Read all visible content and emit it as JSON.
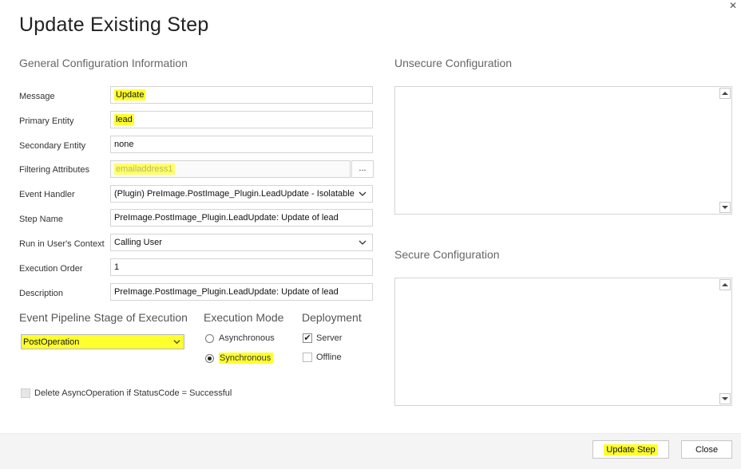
{
  "dialog": {
    "title": "Update Existing Step",
    "close_icon": "close-icon"
  },
  "general": {
    "heading": "General Configuration Information",
    "fields": {
      "message": {
        "label": "Message",
        "value": "Update"
      },
      "primary_entity": {
        "label": "Primary Entity",
        "value": "lead"
      },
      "secondary_entity": {
        "label": "Secondary Entity",
        "value": "none"
      },
      "filtering_attributes": {
        "label": "Filtering Attributes",
        "value": "emailaddress1",
        "button": "..."
      },
      "event_handler": {
        "label": "Event Handler",
        "value": "(Plugin) PreImage.PostImage_Plugin.LeadUpdate - Isolatable"
      },
      "step_name": {
        "label": "Step Name",
        "value": "PreImage.PostImage_Plugin.LeadUpdate: Update of lead"
      },
      "run_in_context": {
        "label": "Run in User's Context",
        "value": "Calling User"
      },
      "execution_order": {
        "label": "Execution Order",
        "value": "1"
      },
      "description": {
        "label": "Description",
        "value": "PreImage.PostImage_Plugin.LeadUpdate: Update of lead"
      }
    }
  },
  "pipeline": {
    "heading": "Event Pipeline Stage of Execution",
    "selected": "PostOperation"
  },
  "execution_mode": {
    "heading": "Execution Mode",
    "options": [
      {
        "label": "Asynchronous",
        "selected": false
      },
      {
        "label": "Synchronous",
        "selected": true
      }
    ]
  },
  "deployment": {
    "heading": "Deployment",
    "options": [
      {
        "label": "Server",
        "checked": true
      },
      {
        "label": "Offline",
        "checked": false
      }
    ]
  },
  "delete_async": {
    "label": "Delete AsyncOperation if StatusCode = Successful",
    "checked": false,
    "disabled": true
  },
  "unsecure": {
    "heading": "Unsecure  Configuration"
  },
  "secure": {
    "heading": "Secure  Configuration"
  },
  "footer": {
    "update_label": "Update Step",
    "close_label": "Close"
  },
  "colors": {
    "highlight": "#ffff2e",
    "field_border": "#d4d4d4",
    "footer_bg": "#f4f4f4"
  }
}
